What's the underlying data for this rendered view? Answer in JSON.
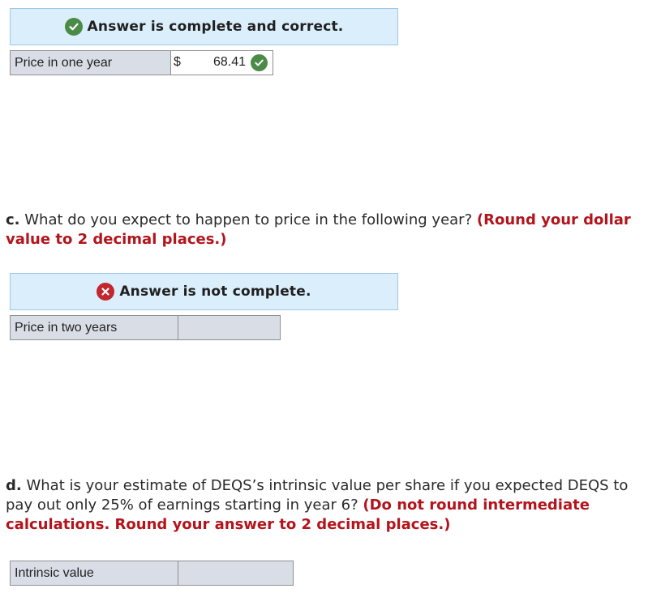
{
  "part_b": {
    "banner_text": "Answer is complete and correct.",
    "row_label": "Price in one year",
    "currency": "$",
    "value": "68.41"
  },
  "part_c": {
    "letter": "c.",
    "question": " What do you expect to happen to price in the following year? ",
    "instruction": "(Round your dollar value to 2 decimal places.)",
    "banner_text": "Answer is not complete.",
    "row_label": "Price in two years"
  },
  "part_d": {
    "letter": "d.",
    "question": " What is your estimate of DEQS’s intrinsic value per share if you expected DEQS to pay out only 25% of earnings starting in year 6? ",
    "instruction": "(Do not round intermediate calculations. Round your answer to 2 decimal places.)",
    "row_label": "Intrinsic value"
  },
  "colors": {
    "banner_bg": "#dbeefb",
    "correct_green": "#4a8b47",
    "incorrect_red": "#c2262e",
    "instruction_red": "#b3141c",
    "cell_gray": "#d9dde6"
  },
  "icons": {
    "correct": "check-circle-icon",
    "incorrect": "x-circle-icon"
  }
}
